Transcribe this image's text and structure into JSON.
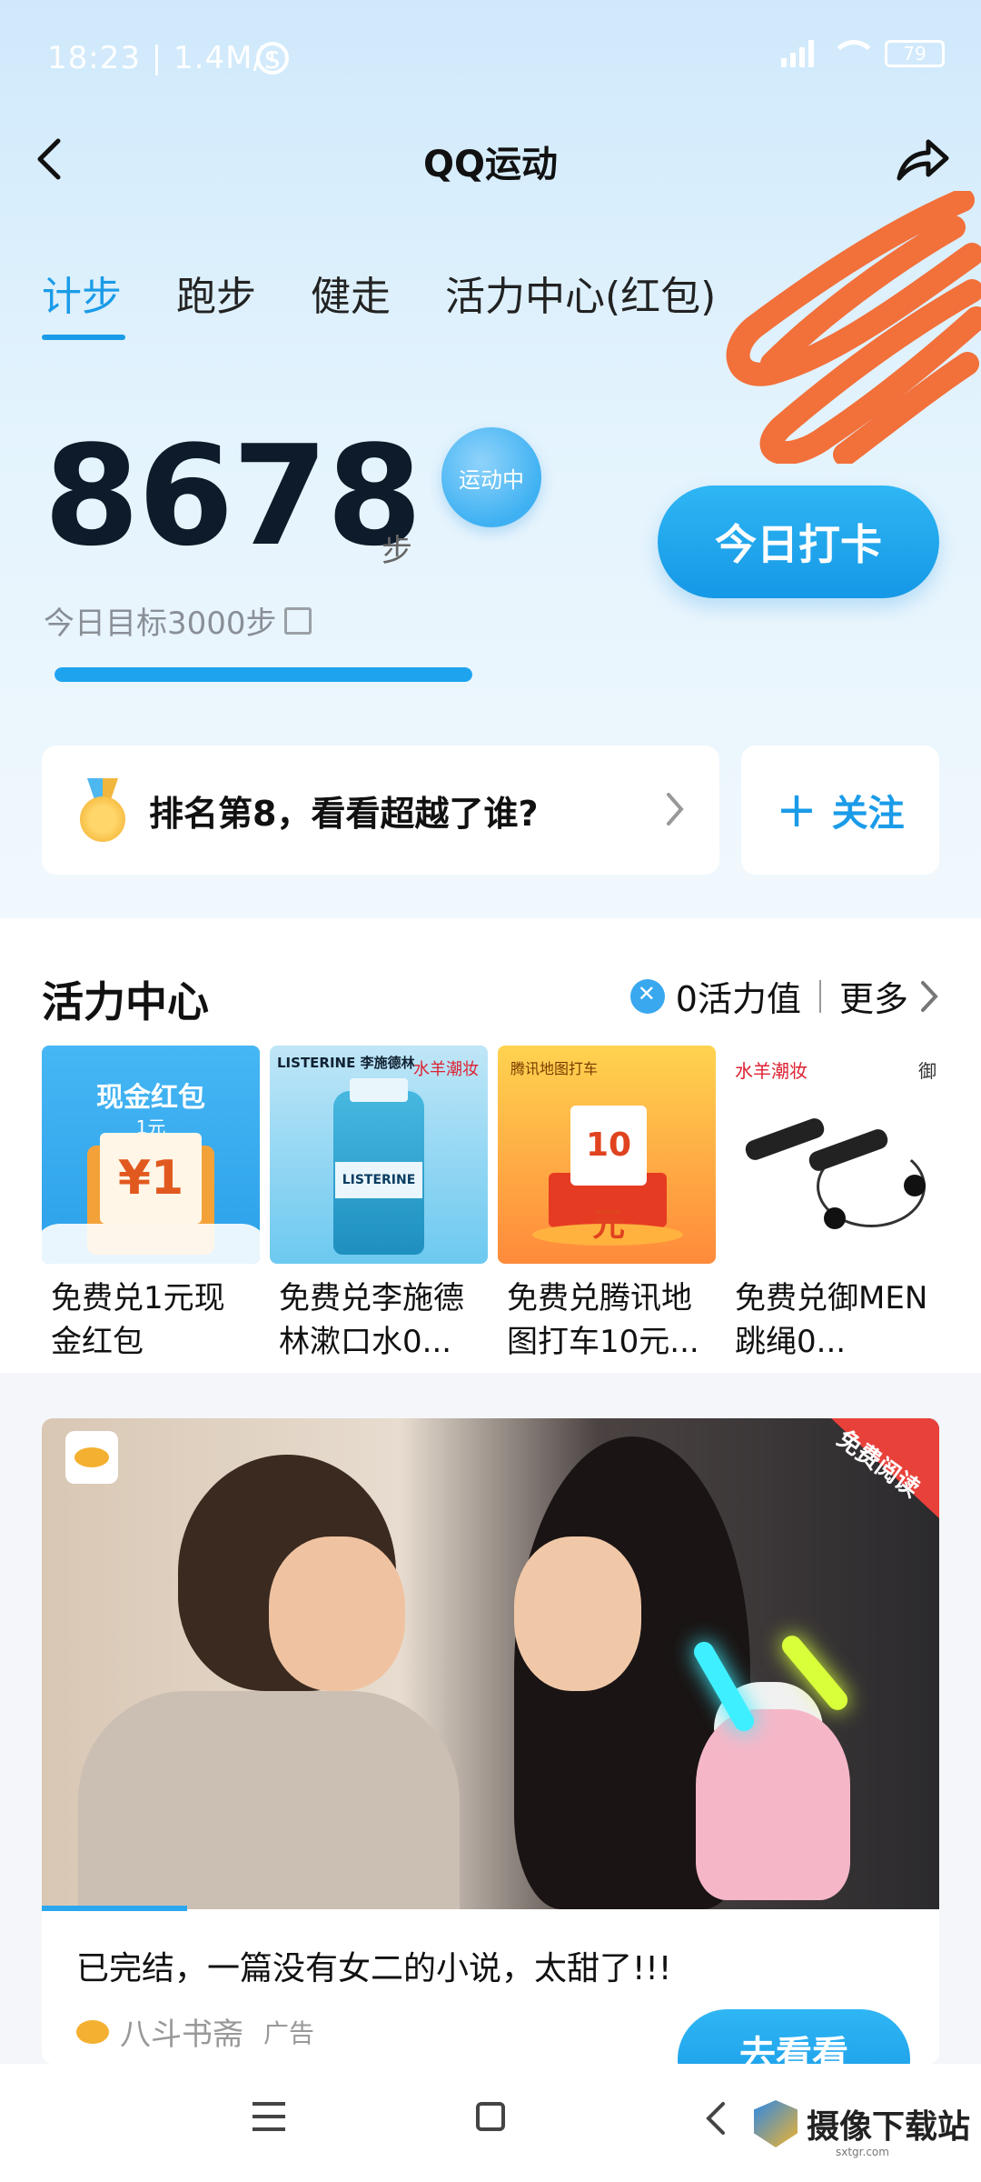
{
  "status_bar": {
    "time": "18:23 | 1.4M/s",
    "battery": "79"
  },
  "header": {
    "title": "QQ运动"
  },
  "tabs": [
    {
      "label": "计步",
      "active": true
    },
    {
      "label": "跑步",
      "active": false
    },
    {
      "label": "健走",
      "active": false
    },
    {
      "label": "活力中心(红包)",
      "active": false
    }
  ],
  "stats": {
    "steps": "8678",
    "unit": "步",
    "badge": "运动中",
    "goal": "今日目标3000步",
    "progress_fraction": 1.0
  },
  "checkin_button": "今日打卡",
  "rank": {
    "text": "排名第8，看看超越了谁?"
  },
  "follow": {
    "label": "关注"
  },
  "vitality": {
    "title": "活力中心",
    "points": "0活力值",
    "more": "更多",
    "products": [
      {
        "name": "免费兑1元现金红包",
        "img_title": "现金红包",
        "img_sub": "1元",
        "img_value": "¥1"
      },
      {
        "name": "免费兑李施德林漱口水0...",
        "img_brand": "LISTERINE 李施德林",
        "img_brand2": "水羊潮妆",
        "img_label": "LISTERINE"
      },
      {
        "name": "免费兑腾讯地图打车10元...",
        "img_brand": "腾讯地图打车",
        "img_value": "10元"
      },
      {
        "name": "免费兑御MEN跳绳0...",
        "img_brand": "水羊潮妆",
        "img_brand2": "御"
      }
    ]
  },
  "ad": {
    "corner_label": "免费阅读",
    "headline": "已完结，一篇没有女二的小说，太甜了!!!",
    "source": "八斗书斋",
    "tag": "广告",
    "cta": "去看看"
  },
  "watermark": {
    "text": "摄像下载站",
    "sub": "sxtgr.com"
  },
  "colors": {
    "accent": "#1a9be8",
    "scribble": "#f2703a"
  }
}
